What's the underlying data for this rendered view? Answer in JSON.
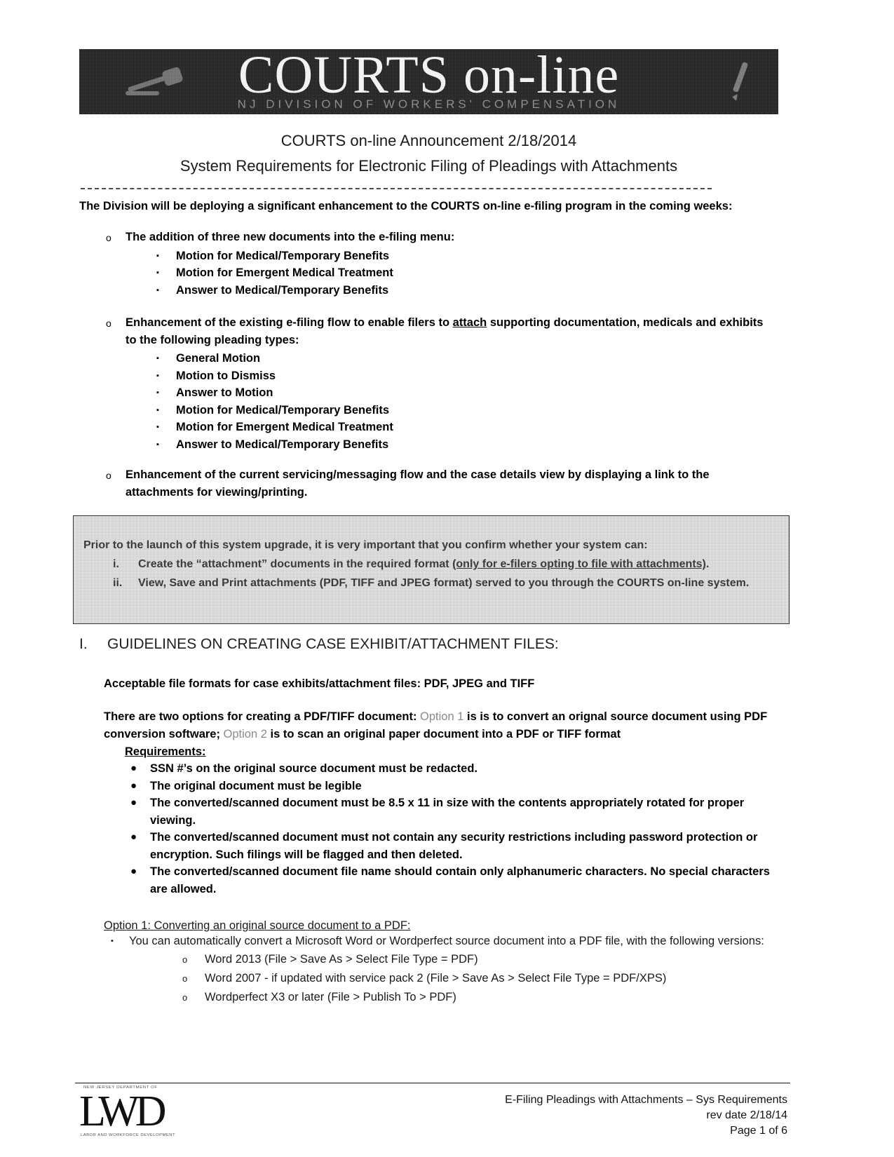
{
  "banner": {
    "title": "COURTS on-line",
    "subtitle": "NJ DIVISION OF WORKERS' COMPENSATION",
    "gavel_icon": "gavel-icon",
    "pen_icon": "pen-icon"
  },
  "header": {
    "line1": "COURTS on-line Announcement 2/18/2014",
    "line2": "System Requirements for Electronic Filing of Pleadings with Attachments"
  },
  "intro": "The Division will be deploying a significant enhancement to the COURTS on-line e-filing program in the coming weeks:",
  "bullets": [
    {
      "marker": "o",
      "text": "The addition of three new documents into the e-filing menu:",
      "sub_marker": "▪",
      "sub": [
        "Motion for Medical/Temporary Benefits",
        "Motion for Emergent Medical Treatment",
        "Answer to Medical/Temporary Benefits"
      ]
    },
    {
      "marker": "o",
      "text_before": "Enhancement of the existing e-filing flow to enable filers to ",
      "text_underlined": "attach",
      "text_after": " supporting documentation, medicals and exhibits to the following pleading types:",
      "sub_marker": "▪",
      "sub": [
        "General Motion",
        "Motion to Dismiss",
        "Answer to Motion",
        "Motion for Medical/Temporary Benefits",
        "Motion for Emergent Medical Treatment",
        "Answer to Medical/Temporary Benefits"
      ]
    },
    {
      "marker": "o",
      "text": "Enhancement of the current servicing/messaging flow and the case details view by displaying a link to the attachments for viewing/printing.",
      "sub": []
    }
  ],
  "callout": {
    "lead": "Prior to the launch of this system upgrade, it is very important that you confirm whether your system can:",
    "items": [
      {
        "numeral": "i.",
        "text_before": "Create the “attachment” documents in the required format ",
        "text_underlined": "(only for e-filers opting to file with attachments)",
        "text_after": "."
      },
      {
        "numeral": "ii.",
        "text_before": "View, Save and Print attachments (PDF, TIFF and JPEG format) served to you through the COURTS on-line system.",
        "text_underlined": "",
        "text_after": ""
      }
    ],
    "background_color": "#b8b8b8",
    "border_color": "#2b2b2b"
  },
  "section1": {
    "number": "I.",
    "title": "GUIDELINES ON CREATING CASE EXHIBIT/ATTACHMENT FILES:",
    "formats_line": "Acceptable file formats for case exhibits/attachment files: PDF, JPEG and TIFF",
    "options_p1": "There are two options for creating a PDF/TIFF document: ",
    "option1_ghost": "Option 1",
    "options_p2": " is is to convert an orignal source document using PDF conversion software; ",
    "option2_ghost": "Option 2",
    "options_p3": " is to scan an original paper document into a PDF or TIFF format",
    "requirements_label": "Requirements:",
    "requirements_marker": "●",
    "requirements": [
      "SSN #’s on the original source document must be redacted.",
      "The original document must be legible",
      "The converted/scanned document must be 8.5 x 11 in size with the contents appropriately rotated for proper viewing.",
      "The converted/scanned document must not contain any security restrictions including password protection or encryption. Such filings will be flagged and then deleted.",
      "The converted/scanned document file name should contain only alphanumeric characters. No special characters are allowed."
    ],
    "option1_heading": "Option 1: Converting an original source document to a PDF:",
    "option1_bullet_marker": "▪",
    "option1_bullet": "You can automatically convert a Microsoft Word  or Wordperfect source document into a PDF file, with the following versions:",
    "option1_sub_marker": "o",
    "option1_subitems": [
      "Word 2013 (File > Save As > Select File Type = PDF)",
      "Word 2007 - if updated with service pack 2 (File > Save As > Select File Type = PDF/XPS)",
      "Wordperfect X3 or later (File > Publish To > PDF)"
    ]
  },
  "footer": {
    "logo_monogram": "LWD",
    "logo_top_text": "NEW JERSEY DEPARTMENT OF",
    "logo_bottom_text": "LABOR AND WORKFORCE DEVELOPMENT",
    "line1": "E-Filing Pleadings with Attachments – Sys Requirements",
    "line2": "rev date 2/18/14",
    "line3": "Page 1 of 6"
  }
}
